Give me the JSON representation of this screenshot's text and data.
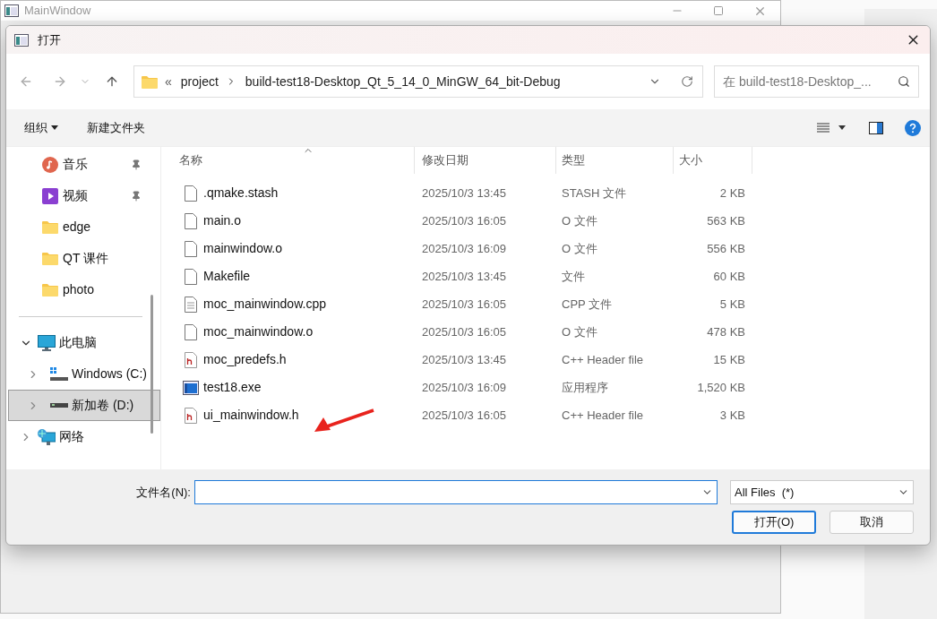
{
  "main_window": {
    "title": "MainWindow"
  },
  "dialog": {
    "title": "打开",
    "address": {
      "prefix": "«",
      "crumbs": [
        "project",
        "build-test18-Desktop_Qt_5_14_0_MinGW_64_bit-Debug"
      ]
    },
    "search": {
      "placeholder": "在 build-test18-Desktop_..."
    },
    "toolbar": [
      "组织",
      "新建文件夹"
    ],
    "sidebar": {
      "items": [
        {
          "kind": "music",
          "label": "音乐",
          "pinned": true
        },
        {
          "kind": "video",
          "label": "视频",
          "pinned": true
        },
        {
          "kind": "folder",
          "label": "edge",
          "pinned": false
        },
        {
          "kind": "folder",
          "label": "QT 课件",
          "pinned": false
        },
        {
          "kind": "folder",
          "label": "photo",
          "pinned": false
        },
        {
          "kind": "separator"
        },
        {
          "kind": "pc",
          "label": "此电脑",
          "expanded": true,
          "selected": false,
          "children": [
            {
              "kind": "os-drive",
              "label": "Windows (C:)",
              "expanded": false,
              "selected": false
            },
            {
              "kind": "drive",
              "label": "新加卷 (D:)",
              "expanded": false,
              "selected": true
            }
          ]
        },
        {
          "kind": "network",
          "label": "网络",
          "expanded": false,
          "selected": false
        }
      ]
    },
    "table": {
      "columns": [
        "名称",
        "修改日期",
        "类型",
        "大小"
      ],
      "rows": [
        {
          "kind": "blank",
          "name": ".qmake.stash",
          "date": "2025/10/3 13:45",
          "type": "STASH 文件",
          "size": "2 KB"
        },
        {
          "kind": "blank",
          "name": "main.o",
          "date": "2025/10/3 16:05",
          "type": "O 文件",
          "size": "563 KB"
        },
        {
          "kind": "blank",
          "name": "mainwindow.o",
          "date": "2025/10/3 16:09",
          "type": "O 文件",
          "size": "556 KB"
        },
        {
          "kind": "blank",
          "name": "Makefile",
          "date": "2025/10/3 13:45",
          "type": "文件",
          "size": "60 KB"
        },
        {
          "kind": "text",
          "name": "moc_mainwindow.cpp",
          "date": "2025/10/3 16:05",
          "type": "CPP 文件",
          "size": "5 KB"
        },
        {
          "kind": "blank",
          "name": "moc_mainwindow.o",
          "date": "2025/10/3 16:05",
          "type": "O 文件",
          "size": "478 KB"
        },
        {
          "kind": "header",
          "name": "moc_predefs.h",
          "date": "2025/10/3 13:45",
          "type": "C++ Header file",
          "size": "15 KB"
        },
        {
          "kind": "exe",
          "name": "test18.exe",
          "date": "2025/10/3 16:09",
          "type": "应用程序",
          "size": "1,520 KB"
        },
        {
          "kind": "header",
          "name": "ui_mainwindow.h",
          "date": "2025/10/3 16:05",
          "type": "C++ Header file",
          "size": "3 KB"
        }
      ]
    },
    "filename": {
      "label": "文件名(N):"
    },
    "filter": {
      "value": "All Files  (*)"
    },
    "buttons": [
      "打开(O)",
      "取消"
    ]
  }
}
